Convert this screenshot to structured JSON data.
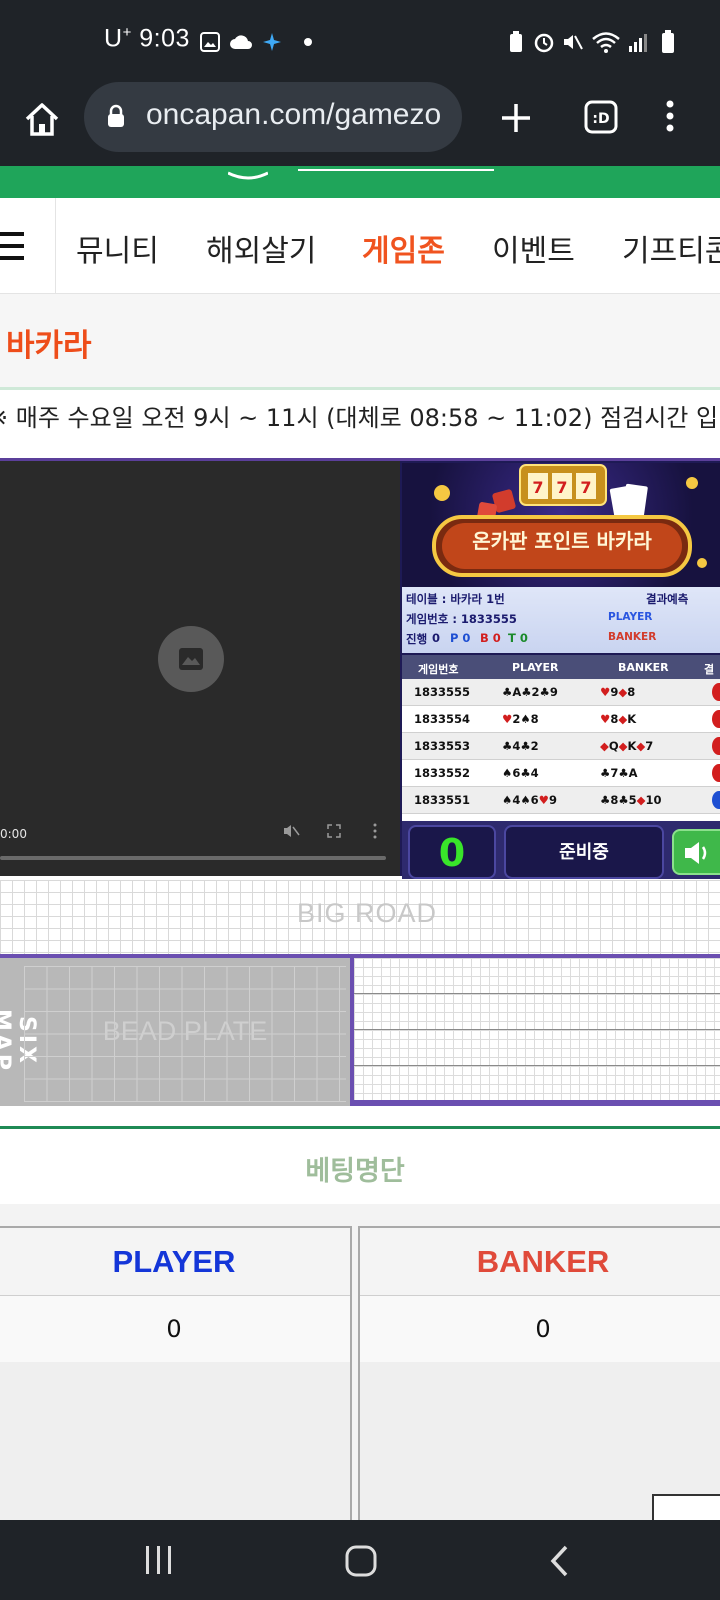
{
  "status_bar": {
    "carrier": "U",
    "carrier_sup": "+",
    "time": "9:03"
  },
  "browser": {
    "url": "oncapan.com/gamezo"
  },
  "nav": {
    "items": [
      {
        "label": "뮤니티",
        "active": false
      },
      {
        "label": "해외살기",
        "active": false
      },
      {
        "label": "게임존",
        "active": true
      },
      {
        "label": "이벤트",
        "active": false
      },
      {
        "label": "기프티콘",
        "active": false
      }
    ]
  },
  "page": {
    "title": "바카라",
    "notice": "※ 매주 수요일 오전 9시 ~ 11시 (대체로 08:58 ~ 11:02) 점검시간 입니다"
  },
  "video": {
    "time": "0:00"
  },
  "game": {
    "banner_title": "온카판 포인트 바카라",
    "table_label": "테이블 : 바카라 1번",
    "predict_label": "결과예측",
    "game_no_label": "게임번호 : 1833555",
    "progress_label": "진행",
    "progress_values": [
      "0",
      "P 0",
      "B 0",
      "T 0"
    ],
    "predict_player": "PLAYER",
    "predict_banker": "BANKER",
    "columns": [
      "게임번호",
      "PLAYER",
      "BANKER",
      "결"
    ],
    "rows": [
      {
        "no": "1833555",
        "player": "♣A♣2♣9",
        "banker": "♥9◆8",
        "result": "banker",
        "result_color": "#d21e1e"
      },
      {
        "no": "1833554",
        "player": "♥2♠8",
        "banker": "♥8◆K",
        "result": "banker",
        "result_color": "#d21e1e"
      },
      {
        "no": "1833553",
        "player": "♣4♣2",
        "banker": "◆Q◆K◆7",
        "result": "banker",
        "result_color": "#d21e1e"
      },
      {
        "no": "1833552",
        "player": "♠6♣4",
        "banker": "♣7♣A",
        "result": "banker",
        "result_color": "#d21e1e"
      },
      {
        "no": "1833551",
        "player": "♠4♠6♥9",
        "banker": "♣8♣5◆10",
        "result": "player",
        "result_color": "#1e4fd2"
      }
    ],
    "counter": "0",
    "status": "준비중",
    "sound_icon": "speaker-icon"
  },
  "roads": {
    "big_road": "BIG ROAD",
    "six_map": "SIX MAP",
    "bead_plate": "BEAD PLATE"
  },
  "bet_list": {
    "title": "베팅명단",
    "player": {
      "label": "PLAYER",
      "value": "0",
      "color": "#1436d8"
    },
    "banker": {
      "label": "BANKER",
      "value": "0",
      "color": "#e04a3a"
    }
  },
  "colors": {
    "accent_orange": "#f0531f",
    "header_green": "#1fa55a",
    "panel_purple": "#5b3f9a",
    "counter_green": "#39e52a"
  }
}
